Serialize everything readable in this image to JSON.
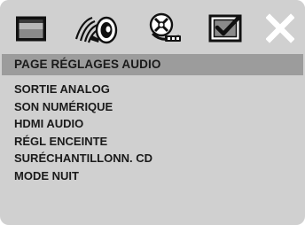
{
  "icons": [
    {
      "name": "display-icon"
    },
    {
      "name": "audio-speaker-icon"
    },
    {
      "name": "video-disc-icon"
    },
    {
      "name": "preferences-check-icon"
    },
    {
      "name": "close-icon"
    }
  ],
  "header": {
    "title": "PAGE RÉGLAGES AUDIO"
  },
  "menu": {
    "items": [
      {
        "label": "SORTIE ANALOG"
      },
      {
        "label": "SON NUMÉRIQUE"
      },
      {
        "label": "HDMI AUDIO"
      },
      {
        "label": "RÉGL ENCEINTE"
      },
      {
        "label": "SURÉCHANTILLONN. CD"
      },
      {
        "label": "MODE NUIT"
      }
    ]
  },
  "colors": {
    "background": "#d0d0d0",
    "header_bar": "#9c9c9c",
    "text": "#1a1a1a",
    "icon_white": "#ffffff"
  }
}
